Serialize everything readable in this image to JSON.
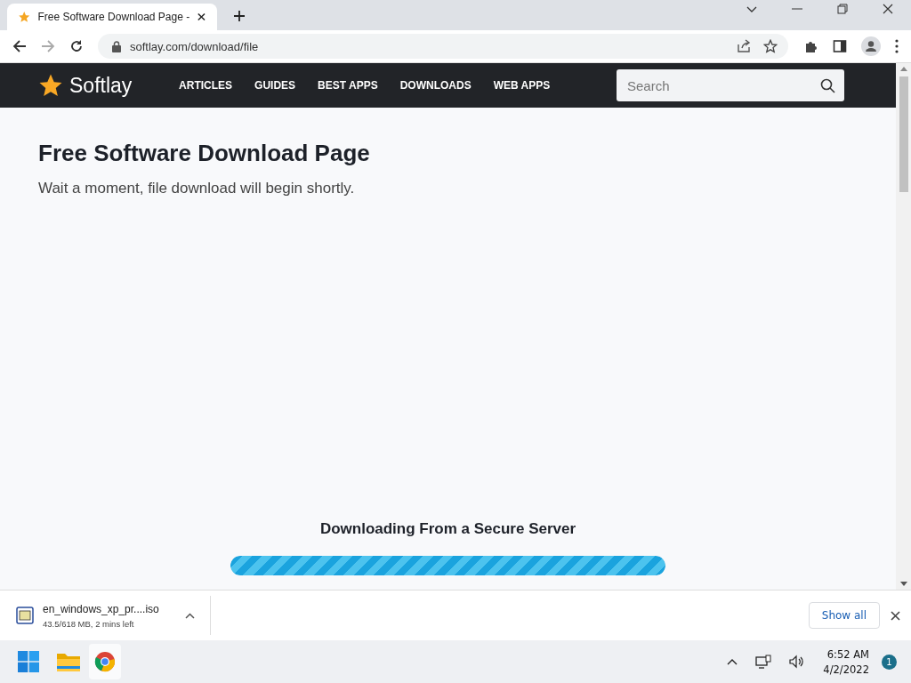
{
  "browser": {
    "tab": {
      "title": "Free Software Download Page -",
      "selected": true
    },
    "address": "softlay.com/download/file"
  },
  "site": {
    "logo": "Softlay",
    "nav": [
      "ARTICLES",
      "GUIDES",
      "BEST APPS",
      "DOWNLOADS",
      "WEB APPS"
    ],
    "search": {
      "placeholder": "Search"
    }
  },
  "page": {
    "title": "Free Software Download Page",
    "subtitle": "Wait a moment, file download will begin shortly.",
    "download_heading": "Downloading From a Secure Server",
    "progress": {
      "level": 1
    }
  },
  "download_shelf": {
    "file": "en_windows_xp_pr....iso",
    "status": "43.5/618 MB, 2 mins left",
    "show_all": "Show all"
  },
  "taskbar": {
    "time": "6:52 AM",
    "date": "4/2/2022",
    "notifications": "1"
  }
}
